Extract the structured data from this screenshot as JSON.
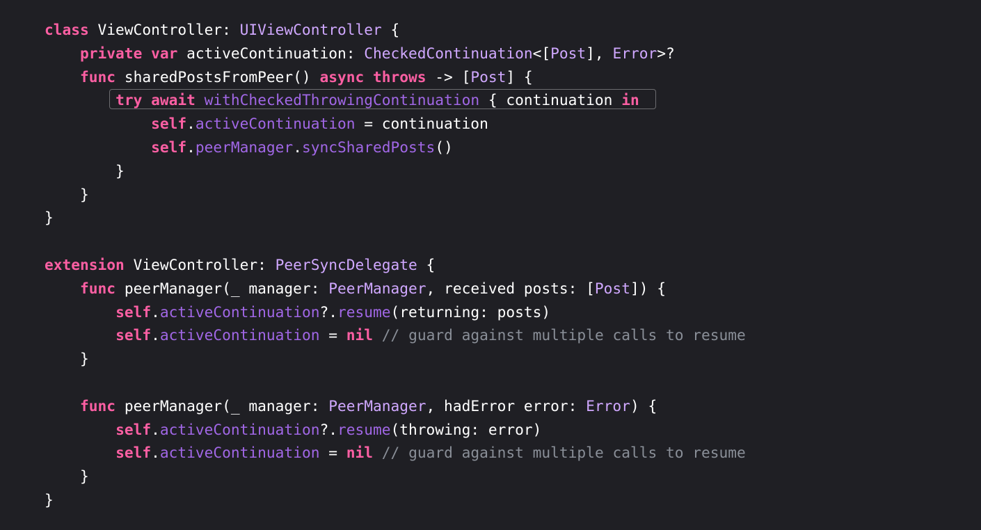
{
  "editor": {
    "background": "#1f1f24",
    "token_colors": {
      "keyword": "#fc5fa3",
      "type": "#d0a8ff",
      "function": "#a167e6",
      "comment": "#8a8f98",
      "text": "#ffffff"
    },
    "highlighted_line": 3,
    "lines": [
      [
        {
          "k": "kw",
          "t": "class"
        },
        {
          "k": "tx",
          "t": " ViewController: "
        },
        {
          "k": "ty",
          "t": "UIViewController"
        },
        {
          "k": "tx",
          "t": " {"
        }
      ],
      [
        {
          "k": "tx",
          "t": "    "
        },
        {
          "k": "kw",
          "t": "private"
        },
        {
          "k": "tx",
          "t": " "
        },
        {
          "k": "kw",
          "t": "var"
        },
        {
          "k": "tx",
          "t": " activeContinuation: "
        },
        {
          "k": "ty",
          "t": "CheckedContinuation"
        },
        {
          "k": "tx",
          "t": "<["
        },
        {
          "k": "ty",
          "t": "Post"
        },
        {
          "k": "tx",
          "t": "], "
        },
        {
          "k": "ty",
          "t": "Error"
        },
        {
          "k": "tx",
          "t": ">?"
        }
      ],
      [
        {
          "k": "tx",
          "t": "    "
        },
        {
          "k": "kw",
          "t": "func"
        },
        {
          "k": "tx",
          "t": " sharedPostsFromPeer() "
        },
        {
          "k": "kw",
          "t": "async"
        },
        {
          "k": "tx",
          "t": " "
        },
        {
          "k": "kw",
          "t": "throws"
        },
        {
          "k": "tx",
          "t": " -> ["
        },
        {
          "k": "ty",
          "t": "Post"
        },
        {
          "k": "tx",
          "t": "] {"
        }
      ],
      [
        {
          "k": "tx",
          "t": "        "
        },
        {
          "k": "kw",
          "t": "try"
        },
        {
          "k": "tx",
          "t": " "
        },
        {
          "k": "kw",
          "t": "await"
        },
        {
          "k": "tx",
          "t": " "
        },
        {
          "k": "fn",
          "t": "withCheckedThrowingContinuation"
        },
        {
          "k": "tx",
          "t": " { continuation "
        },
        {
          "k": "kw",
          "t": "in"
        }
      ],
      [
        {
          "k": "tx",
          "t": "            "
        },
        {
          "k": "kw",
          "t": "self"
        },
        {
          "k": "tx",
          "t": "."
        },
        {
          "k": "fn",
          "t": "activeContinuation"
        },
        {
          "k": "tx",
          "t": " = continuation"
        }
      ],
      [
        {
          "k": "tx",
          "t": "            "
        },
        {
          "k": "kw",
          "t": "self"
        },
        {
          "k": "tx",
          "t": "."
        },
        {
          "k": "fn",
          "t": "peerManager"
        },
        {
          "k": "tx",
          "t": "."
        },
        {
          "k": "fn",
          "t": "syncSharedPosts"
        },
        {
          "k": "tx",
          "t": "()"
        }
      ],
      [
        {
          "k": "tx",
          "t": "        }"
        }
      ],
      [
        {
          "k": "tx",
          "t": "    }"
        }
      ],
      [
        {
          "k": "tx",
          "t": "}"
        }
      ],
      [],
      [
        {
          "k": "kw",
          "t": "extension"
        },
        {
          "k": "tx",
          "t": " ViewController: "
        },
        {
          "k": "ty",
          "t": "PeerSyncDelegate"
        },
        {
          "k": "tx",
          "t": " {"
        }
      ],
      [
        {
          "k": "tx",
          "t": "    "
        },
        {
          "k": "kw",
          "t": "func"
        },
        {
          "k": "tx",
          "t": " peerManager(_ manager: "
        },
        {
          "k": "ty",
          "t": "PeerManager"
        },
        {
          "k": "tx",
          "t": ", received posts: ["
        },
        {
          "k": "ty",
          "t": "Post"
        },
        {
          "k": "tx",
          "t": "]) {"
        }
      ],
      [
        {
          "k": "tx",
          "t": "        "
        },
        {
          "k": "kw",
          "t": "self"
        },
        {
          "k": "tx",
          "t": "."
        },
        {
          "k": "fn",
          "t": "activeContinuation"
        },
        {
          "k": "tx",
          "t": "?."
        },
        {
          "k": "fn",
          "t": "resume"
        },
        {
          "k": "tx",
          "t": "(returning: posts)"
        }
      ],
      [
        {
          "k": "tx",
          "t": "        "
        },
        {
          "k": "kw",
          "t": "self"
        },
        {
          "k": "tx",
          "t": "."
        },
        {
          "k": "fn",
          "t": "activeContinuation"
        },
        {
          "k": "tx",
          "t": " = "
        },
        {
          "k": "kw",
          "t": "nil"
        },
        {
          "k": "tx",
          "t": " "
        },
        {
          "k": "cm",
          "t": "// guard against multiple calls to resume"
        }
      ],
      [
        {
          "k": "tx",
          "t": "    }"
        }
      ],
      [],
      [
        {
          "k": "tx",
          "t": "    "
        },
        {
          "k": "kw",
          "t": "func"
        },
        {
          "k": "tx",
          "t": " peerManager(_ manager: "
        },
        {
          "k": "ty",
          "t": "PeerManager"
        },
        {
          "k": "tx",
          "t": ", hadError error: "
        },
        {
          "k": "ty",
          "t": "Error"
        },
        {
          "k": "tx",
          "t": ") {"
        }
      ],
      [
        {
          "k": "tx",
          "t": "        "
        },
        {
          "k": "kw",
          "t": "self"
        },
        {
          "k": "tx",
          "t": "."
        },
        {
          "k": "fn",
          "t": "activeContinuation"
        },
        {
          "k": "tx",
          "t": "?."
        },
        {
          "k": "fn",
          "t": "resume"
        },
        {
          "k": "tx",
          "t": "(throwing: error)"
        }
      ],
      [
        {
          "k": "tx",
          "t": "        "
        },
        {
          "k": "kw",
          "t": "self"
        },
        {
          "k": "tx",
          "t": "."
        },
        {
          "k": "fn",
          "t": "activeContinuation"
        },
        {
          "k": "tx",
          "t": " = "
        },
        {
          "k": "kw",
          "t": "nil"
        },
        {
          "k": "tx",
          "t": " "
        },
        {
          "k": "cm",
          "t": "// guard against multiple calls to resume"
        }
      ],
      [
        {
          "k": "tx",
          "t": "    }"
        }
      ],
      [
        {
          "k": "tx",
          "t": "}"
        }
      ]
    ]
  }
}
